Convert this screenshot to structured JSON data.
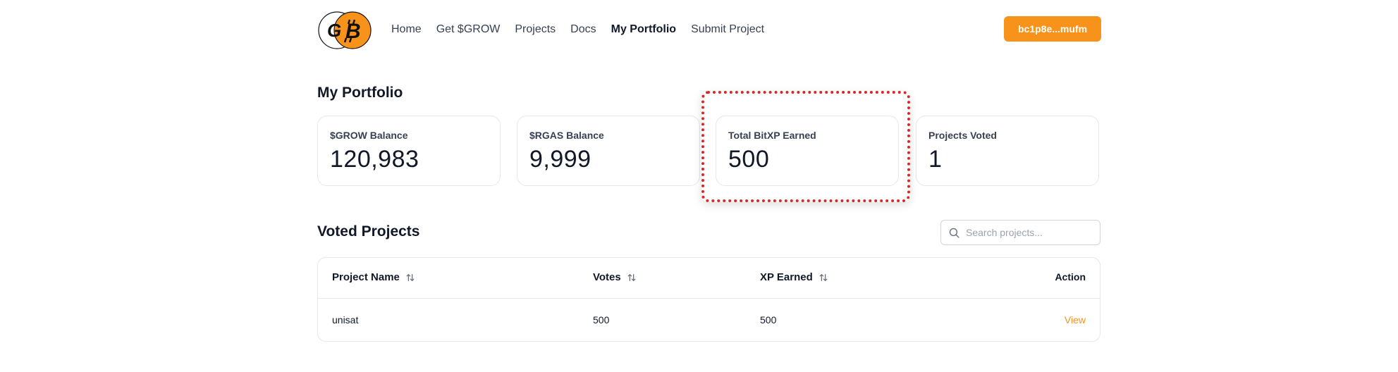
{
  "header": {
    "logo_letters": [
      "G",
      "B"
    ],
    "nav": [
      {
        "label": "Home",
        "active": false
      },
      {
        "label": "Get $GROW",
        "active": false
      },
      {
        "label": "Projects",
        "active": false
      },
      {
        "label": "Docs",
        "active": false
      },
      {
        "label": "My Portfolio",
        "active": true
      },
      {
        "label": "Submit Project",
        "active": false
      }
    ],
    "wallet_label": "bc1p8e...mufm"
  },
  "portfolio": {
    "title": "My Portfolio",
    "cards": [
      {
        "label": "$GROW Balance",
        "value": "120,983"
      },
      {
        "label": "$RGAS Balance",
        "value": "9,999"
      },
      {
        "label": "Total BitXP Earned",
        "value": "500"
      },
      {
        "label": "Projects Voted",
        "value": "1"
      }
    ]
  },
  "voted": {
    "title": "Voted Projects",
    "search_placeholder": "Search projects...",
    "columns": [
      "Project Name",
      "Votes",
      "XP Earned",
      "Action"
    ],
    "rows": [
      {
        "project": "unisat",
        "votes": "500",
        "xp": "500",
        "action": "View"
      }
    ]
  },
  "colors": {
    "accent": "#f7931a",
    "highlight": "#dc2626",
    "border": "#e5e7eb"
  },
  "icons": [
    "logo-icon",
    "sort-icon",
    "search-icon"
  ]
}
